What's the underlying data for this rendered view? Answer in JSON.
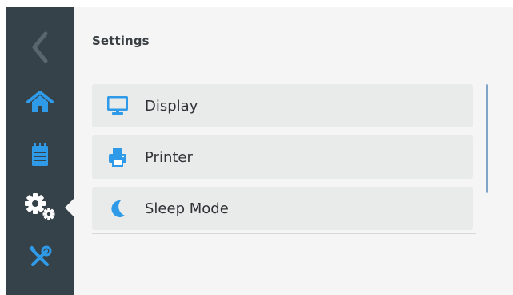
{
  "sidebar": {
    "items": [
      {
        "icon": "chevron-left-icon",
        "active": false
      },
      {
        "icon": "home-icon",
        "active": false
      },
      {
        "icon": "notepad-icon",
        "active": false
      },
      {
        "icon": "gears-icon",
        "active": true
      },
      {
        "icon": "tools-icon",
        "active": false
      }
    ]
  },
  "main": {
    "title": "Settings",
    "items": [
      {
        "label": "Display",
        "icon": "monitor-icon"
      },
      {
        "label": "Printer",
        "icon": "printer-icon"
      },
      {
        "label": "Sleep Mode",
        "icon": "moon-icon"
      }
    ]
  },
  "colors": {
    "sidebar_bg": "#36424a",
    "accent": "#2f9be8",
    "content_bg": "#f4f5f4",
    "item_bg": "#e9eaea"
  }
}
